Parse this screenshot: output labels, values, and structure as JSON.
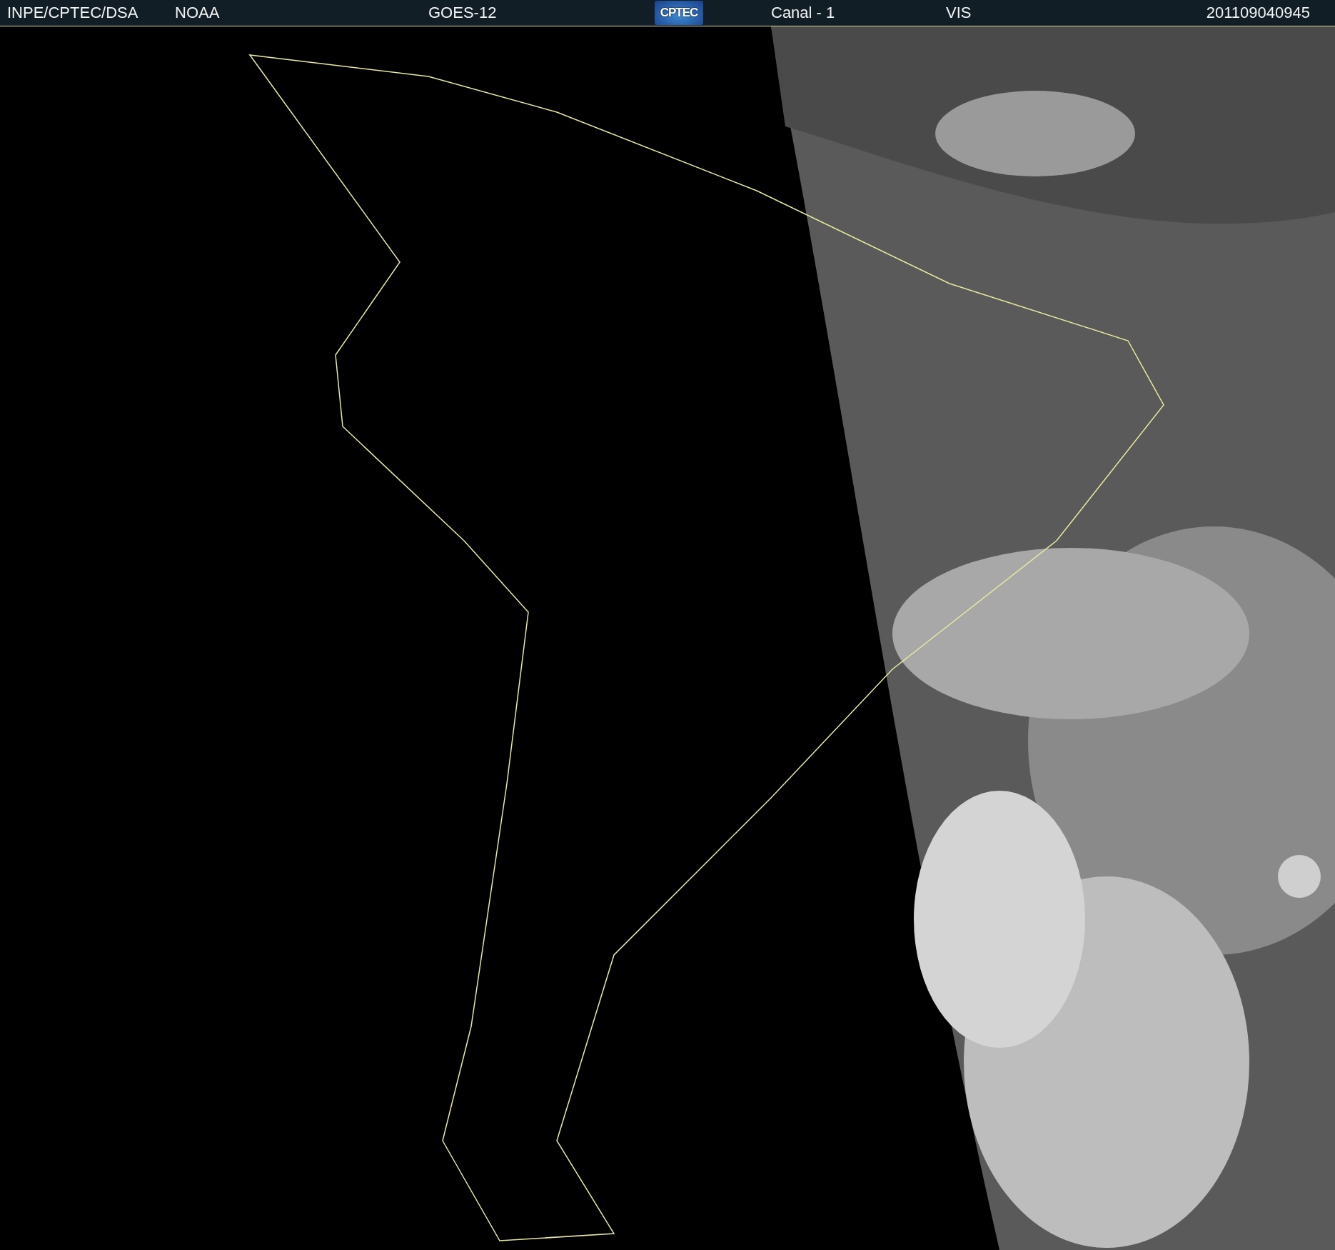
{
  "header": {
    "source": "INPE/CPTEC/DSA",
    "agency": "NOAA",
    "satellite": "GOES-12",
    "logo": "CPTEC",
    "channel": "Canal - 1",
    "band": "VIS",
    "timestamp": "201109040945"
  }
}
